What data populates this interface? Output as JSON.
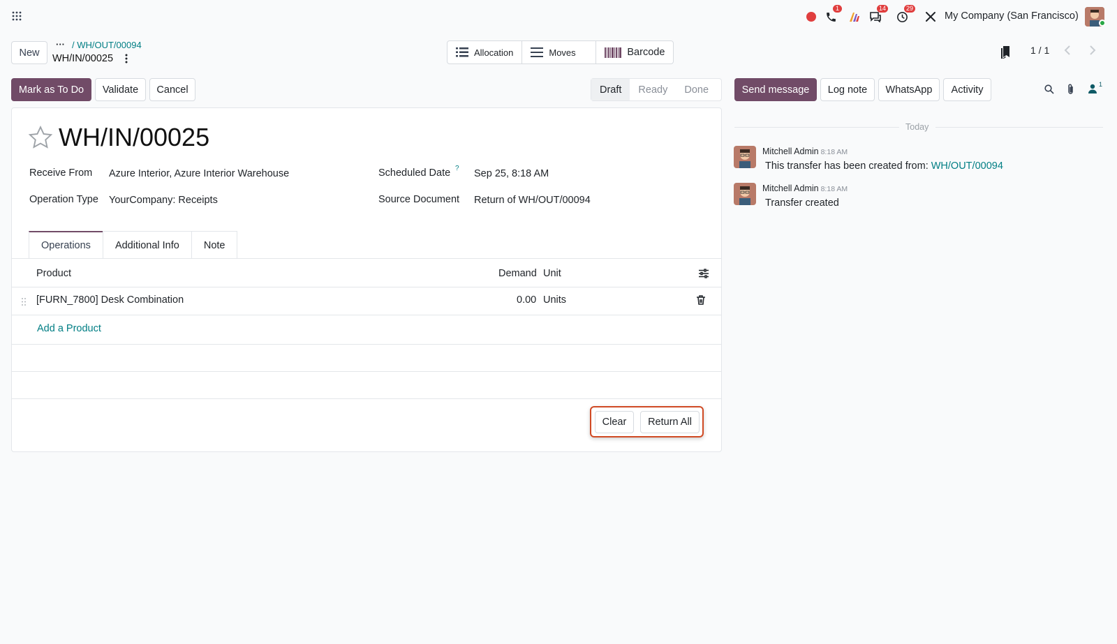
{
  "topbar": {
    "company": "My Company (San Francisco)",
    "badges": {
      "phone": "1",
      "discuss": "14",
      "activity": "29"
    }
  },
  "breadcrumb": {
    "parent": "/ WH/OUT/00094",
    "current": "WH/IN/00025"
  },
  "buttons": {
    "new": "New",
    "mark_todo": "Mark as To Do",
    "validate": "Validate",
    "cancel": "Cancel",
    "clear": "Clear",
    "return_all": "Return All"
  },
  "smart_buttons": {
    "allocation": "Allocation",
    "moves": "Moves",
    "barcode": "Barcode"
  },
  "pager": "1 / 1",
  "status": {
    "draft": "Draft",
    "ready": "Ready",
    "done": "Done"
  },
  "record": {
    "name": "WH/IN/00025",
    "receive_from_label": "Receive From",
    "receive_from": "Azure Interior, Azure Interior Warehouse",
    "operation_type_label": "Operation Type",
    "operation_type": "YourCompany: Receipts",
    "scheduled_date_label": "Scheduled Date",
    "scheduled_date_help": "?",
    "scheduled_date": "Sep 25, 8:18 AM",
    "source_document_label": "Source Document",
    "source_document": "Return of WH/OUT/00094"
  },
  "tabs": [
    "Operations",
    "Additional Info",
    "Note"
  ],
  "table": {
    "headers": {
      "product": "Product",
      "demand": "Demand",
      "unit": "Unit"
    },
    "rows": [
      {
        "product": "[FURN_7800] Desk Combination",
        "demand": "0.00",
        "unit": "Units"
      }
    ],
    "add_product": "Add a Product"
  },
  "chatter": {
    "send_message": "Send message",
    "log_note": "Log note",
    "whatsapp": "WhatsApp",
    "activity": "Activity",
    "followers": "1",
    "today": "Today",
    "messages": [
      {
        "author": "Mitchell Admin",
        "time": "8:18 AM",
        "text": "This transfer has been created from: ",
        "link": "WH/OUT/00094"
      },
      {
        "author": "Mitchell Admin",
        "time": "8:18 AM",
        "text": "Transfer created"
      }
    ]
  },
  "colors": {
    "brand": "#714b67",
    "link": "#017e84",
    "highlight": "#d04a24"
  }
}
